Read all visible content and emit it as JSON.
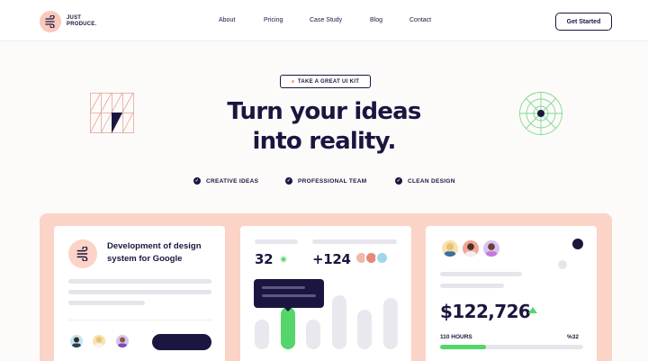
{
  "nav": {
    "logo_line1": "JUST",
    "logo_line2": "PRODUCE.",
    "links": [
      "About",
      "Pricing",
      "Case Study",
      "Blog",
      "Contact"
    ],
    "cta": "Get Started"
  },
  "hero": {
    "badge": "TAKE A GREAT UI KIT",
    "title_line1": "Turn your ideas",
    "title_line2": "into reality.",
    "features": [
      "CREATIVE IDEAS",
      "PROFESSIONAL TEAM",
      "CLEAN DESIGN"
    ]
  },
  "card1": {
    "title": "Development of design system for Google"
  },
  "card2": {
    "stat1": "32",
    "stat2": "+124",
    "bars": [
      0.55,
      0.78,
      0.55,
      1.0,
      0.74,
      0.95
    ],
    "active_bar": 1
  },
  "card3": {
    "amount": "$122,726",
    "hours": "110 HOURS",
    "percent": "%32",
    "progress": 0.32
  },
  "colors": {
    "navy": "#1b1640",
    "peach": "#fbd3c7",
    "green": "#54d66a"
  }
}
